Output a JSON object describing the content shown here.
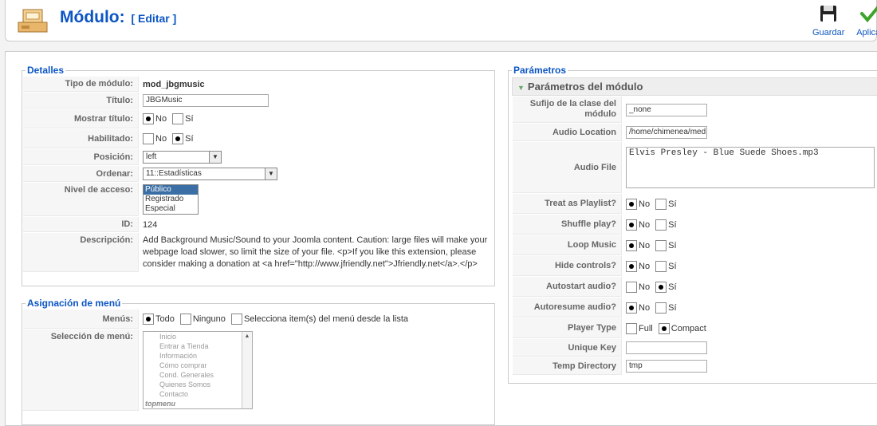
{
  "header": {
    "title": "Módulo:",
    "subtitle": "[ Editar ]",
    "save_label": "Guardar",
    "apply_label": "Aplicar"
  },
  "details": {
    "legend": "Detalles",
    "module_type": {
      "label": "Tipo de módulo:",
      "value": "mod_jbgmusic"
    },
    "title": {
      "label": "Título:",
      "value": "JBGMusic"
    },
    "show_title": {
      "label": "Mostrar título:",
      "no": "No",
      "yes": "Sí",
      "selected": "No"
    },
    "enabled": {
      "label": "Habilitado:",
      "no": "No",
      "yes": "Sí",
      "selected": "Sí"
    },
    "position": {
      "label": "Posición:",
      "value": "left"
    },
    "order": {
      "label": "Ordenar:",
      "value": "11::Estadísticas"
    },
    "access": {
      "label": "Nivel de acceso:",
      "options": [
        "Público",
        "Registrado",
        "Especial"
      ],
      "selected": "Público"
    },
    "id": {
      "label": "ID:",
      "value": "124"
    },
    "description": {
      "label": "Descripción:",
      "value": "Add Background Music/Sound to your Joomla content. Caution: large files will make your webpage load slower, so limit the size of your file. <p>If you like this extension, please consider making a donation at <a href=\"http://www.jfriendly.net\">Jfriendly.net</a>.</p>"
    }
  },
  "menu_assignment": {
    "legend": "Asignación de menú",
    "menus": {
      "label": "Menús:",
      "all": "Todo",
      "none": "Ninguno",
      "select": "Selecciona item(s) del menú desde la lista",
      "selected": "Todo"
    },
    "selection": {
      "label": "Selección de menú:",
      "items": [
        "Inicio",
        "Entrar a Tienda",
        "Información",
        "Cómo comprar",
        "Cond. Generales",
        "Quienes Somos",
        "Contacto"
      ],
      "group": "topmenu"
    }
  },
  "params": {
    "legend": "Parámetros",
    "panel_title": "Parámetros del módulo",
    "suffix": {
      "label": "Sufijo de la clase del módulo",
      "value": "_none"
    },
    "audio_location": {
      "label": "Audio Location",
      "value": "/home/chimenea/med"
    },
    "audio_file": {
      "label": "Audio File",
      "value": "Elvis Presley - Blue Suede Shoes.mp3"
    },
    "playlist": {
      "label": "Treat as Playlist?",
      "no": "No",
      "yes": "Sí",
      "selected": "No"
    },
    "shuffle": {
      "label": "Shuffle play?",
      "no": "No",
      "yes": "Sí",
      "selected": "No"
    },
    "loop": {
      "label": "Loop Music",
      "no": "No",
      "yes": "Sí",
      "selected": "No"
    },
    "hide_controls": {
      "label": "Hide controls?",
      "no": "No",
      "yes": "Sí",
      "selected": "No"
    },
    "autostart": {
      "label": "Autostart audio?",
      "no": "No",
      "yes": "Sí",
      "selected": "Sí"
    },
    "autoresume": {
      "label": "Autoresume audio?",
      "no": "No",
      "yes": "Sí",
      "selected": "No"
    },
    "player_type": {
      "label": "Player Type",
      "full": "Full",
      "compact": "Compact",
      "selected": "Compact"
    },
    "unique_key": {
      "label": "Unique Key",
      "value": ""
    },
    "temp_dir": {
      "label": "Temp Directory",
      "value": "tmp"
    }
  },
  "colors": {
    "accent": "#0b55c4",
    "apply_check": "#3aa52a"
  },
  "icons": {
    "header": "module-icon",
    "save": "floppy-disk-icon",
    "apply": "checkmark-icon"
  }
}
